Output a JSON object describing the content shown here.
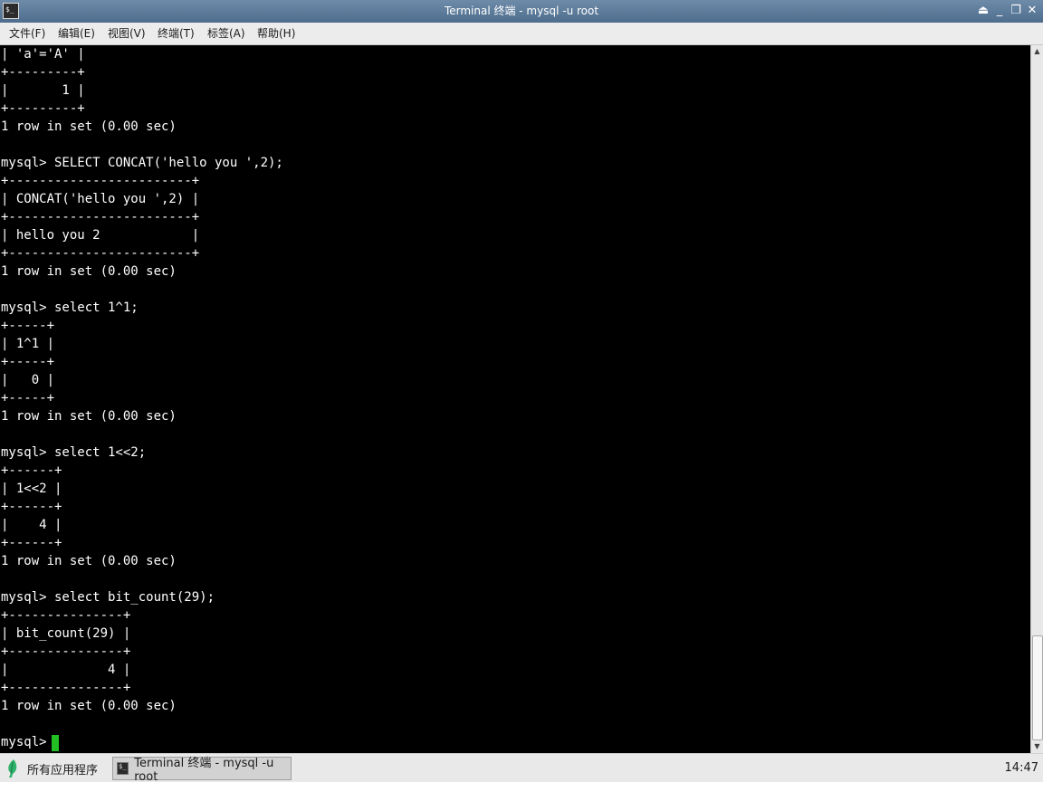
{
  "window": {
    "title": "Terminal 终端 - mysql -u root",
    "app_icon_glyph": "$_",
    "controls": {
      "shade_icon": "⏏",
      "minimize_icon": "_",
      "restore_icon": "❐",
      "close_icon": "✕"
    }
  },
  "menu": {
    "items": [
      {
        "label": "文件(F)"
      },
      {
        "label": "编辑(E)"
      },
      {
        "label": "视图(V)"
      },
      {
        "label": "终端(T)"
      },
      {
        "label": "标签(A)"
      },
      {
        "label": "帮助(H)"
      }
    ]
  },
  "terminal": {
    "background": "#000000",
    "foreground": "#ffffff",
    "cursor_color": "#22c022",
    "lines": [
      "| 'a'='A' |",
      "+---------+",
      "|       1 |",
      "+---------+",
      "1 row in set (0.00 sec)",
      "",
      "mysql> SELECT CONCAT('hello you ',2);",
      "+------------------------+",
      "| CONCAT('hello you ',2) |",
      "+------------------------+",
      "| hello you 2            |",
      "+------------------------+",
      "1 row in set (0.00 sec)",
      "",
      "mysql> select 1^1;",
      "+-----+",
      "| 1^1 |",
      "+-----+",
      "|   0 |",
      "+-----+",
      "1 row in set (0.00 sec)",
      "",
      "mysql> select 1<<2;",
      "+------+",
      "| 1<<2 |",
      "+------+",
      "|    4 |",
      "+------+",
      "1 row in set (0.00 sec)",
      "",
      "mysql> select bit_count(29);",
      "+---------------+",
      "| bit_count(29) |",
      "+---------------+",
      "|             4 |",
      "+---------------+",
      "1 row in set (0.00 sec)",
      ""
    ],
    "prompt": "mysql> "
  },
  "scrollbar": {
    "up_arrow_icon": "▲",
    "down_arrow_icon": "▼",
    "position_fraction": 0.95
  },
  "taskbar": {
    "start_label": "所有应用程序",
    "start_icon": "leaf-icon",
    "task_label": "Terminal 终端 - mysql -u root",
    "task_icon_glyph": "$_",
    "clock": "14:47"
  }
}
